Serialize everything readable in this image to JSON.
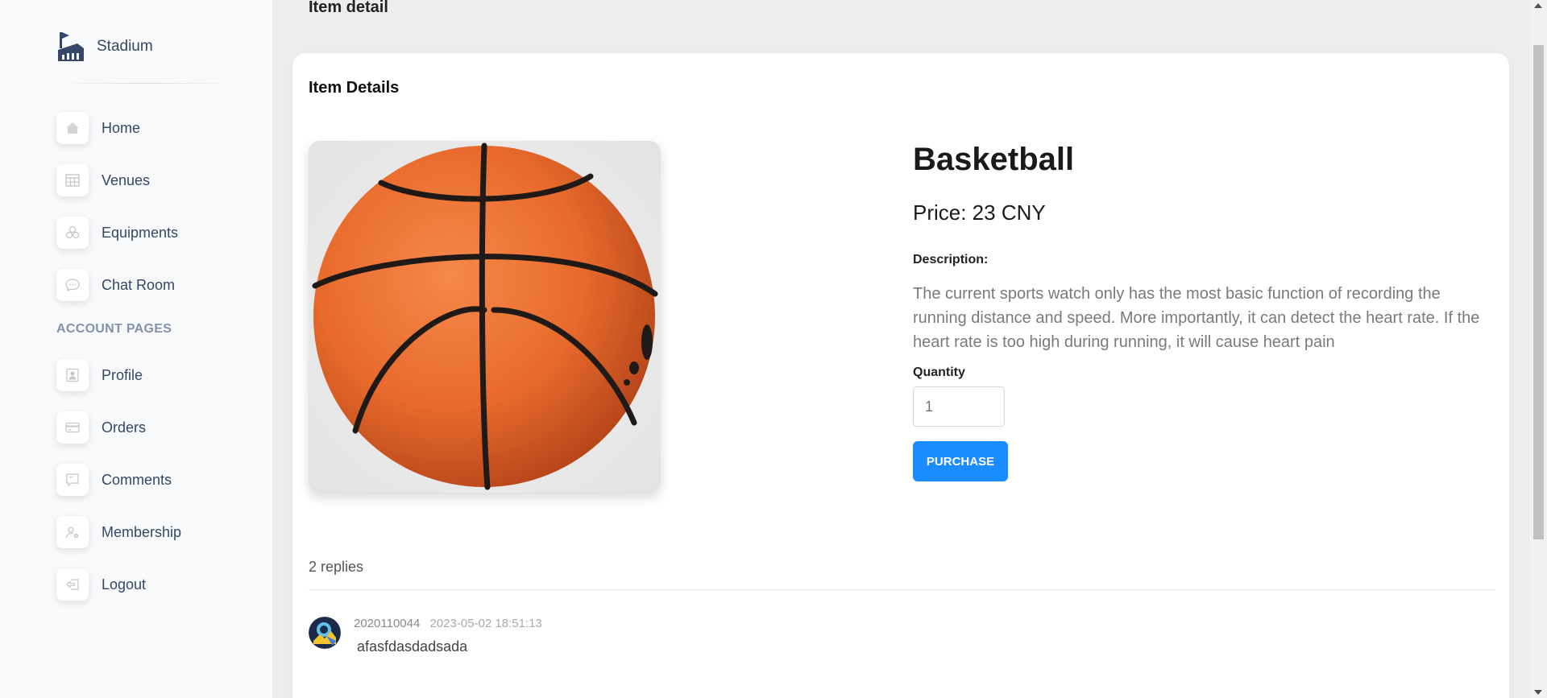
{
  "app": {
    "name": "Stadium"
  },
  "sidebar": {
    "items": [
      {
        "label": "Home",
        "icon": "home-icon"
      },
      {
        "label": "Venues",
        "icon": "table-icon"
      },
      {
        "label": "Equipments",
        "icon": "cubes-icon"
      },
      {
        "label": "Chat Room",
        "icon": "chat-icon"
      }
    ],
    "section_title": "ACCOUNT PAGES",
    "account_items": [
      {
        "label": "Profile",
        "icon": "user-card-icon"
      },
      {
        "label": "Orders",
        "icon": "credit-card-icon"
      },
      {
        "label": "Comments",
        "icon": "quote-bubble-icon"
      },
      {
        "label": "Membership",
        "icon": "user-settings-icon"
      },
      {
        "label": "Logout",
        "icon": "logout-icon"
      }
    ]
  },
  "page": {
    "title": "Item detail"
  },
  "card": {
    "title": "Item Details"
  },
  "product": {
    "name": "Basketball",
    "price": "Price: 23 CNY",
    "description_label": "Description:",
    "description": "The current sports watch only has the most basic function of recording the running distance and speed. More importantly, it can detect the heart rate. If the heart rate is too high during running, it will cause heart pain",
    "quantity_label": "Quantity",
    "quantity_placeholder": "1",
    "purchase_label": "PURCHASE"
  },
  "comments": {
    "count_label": "2 replies",
    "items": [
      {
        "user": "2020110044",
        "time": "2023-05-02 18:51:13",
        "text": "afasfdasdadsada"
      }
    ]
  },
  "colors": {
    "accent": "#1a8cff",
    "sidebar_bg": "#f8f9fa",
    "page_bg": "#ededed"
  }
}
